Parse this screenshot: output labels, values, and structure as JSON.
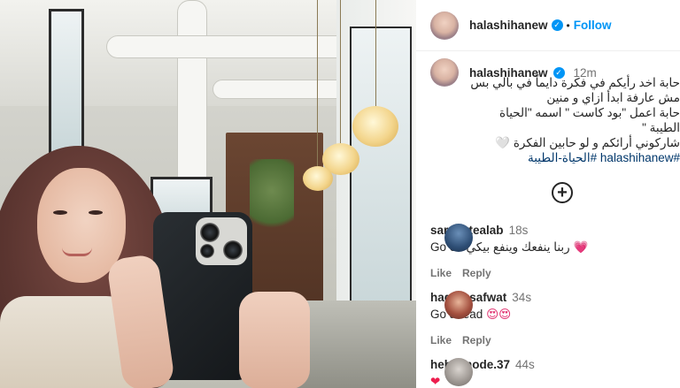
{
  "post": {
    "username": "halashihanew",
    "follow_label": "Follow",
    "separator": "•",
    "verified_mark": "✓"
  },
  "caption": {
    "username": "halashihanew",
    "time": "12m",
    "lines": [
      "حابة اخد رأيكم في فكرة دايماً في بالي بس",
      "مش عارفة ابدأ ازاي و منين",
      "حابة اعمل \"بود كاست \" اسمه \"الحياة",
      "الطيبة \"",
      "شاركوني أرائكم و لو حابين الفكرة 🤍"
    ],
    "hashtags": "#halashihanew #الحياة-الطيبة"
  },
  "more_comments_icon": "plus-circle-icon",
  "more_comments_glyph": "+",
  "comments": [
    {
      "username": "sarah_tealab",
      "time": "18s",
      "text": "Go on ربنا ينفعك وينفع بيكي",
      "emoji": "💗",
      "like_label": "Like",
      "reply_label": "Reply"
    },
    {
      "username": "hagar_safwat",
      "time": "34s",
      "text": "Go ahead",
      "emoji": "😍😍",
      "like_label": "Like",
      "reply_label": "Reply"
    },
    {
      "username": "heba.mode.37",
      "time": "44s",
      "text": "",
      "emoji": "❤",
      "like_label": "",
      "reply_label": ""
    }
  ],
  "colors": {
    "follow": "#0095f6",
    "verified": "#0095f6",
    "hashtag": "#00376b",
    "muted": "#737373"
  }
}
